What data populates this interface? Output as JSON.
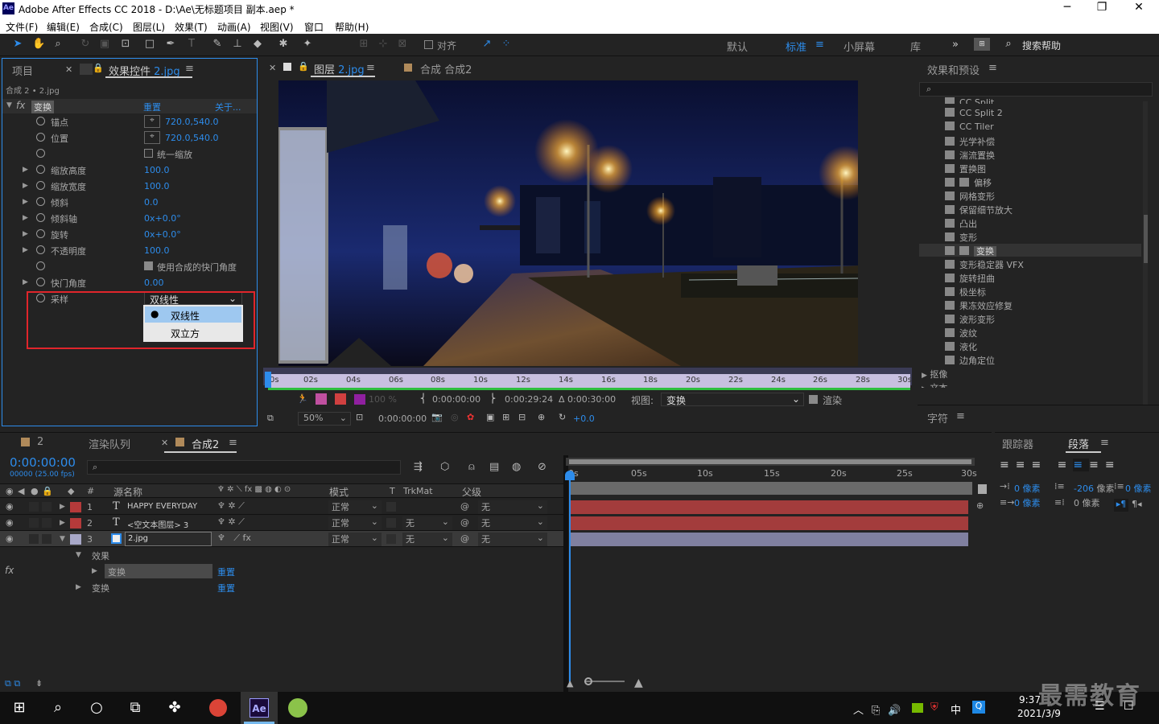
{
  "window": {
    "title": "Adobe After Effects CC 2018 - D:\\Ae\\无标题项目 副本.aep *",
    "logo": "Ae",
    "minimize": "─",
    "restore": "❐",
    "close": "✕"
  },
  "menu": [
    "文件(F)",
    "编辑(E)",
    "合成(C)",
    "图层(L)",
    "效果(T)",
    "动画(A)",
    "视图(V)",
    "窗口",
    "帮助(H)"
  ],
  "toolbar": {
    "align_label": "对齐",
    "workspaces": [
      "默认",
      "标准",
      "小屏幕",
      "库"
    ],
    "active_workspace": "标准",
    "search_help": "搜索帮助",
    "more": "»"
  },
  "left_panel": {
    "tab_project": "项目",
    "tab_effects_prefix": "效果控件",
    "tab_effects_layer": "2.jpg",
    "breadcrumb": "合成 2 • 2.jpg",
    "effect_name": "变换",
    "reset": "重置",
    "about": "关于...",
    "props": [
      {
        "label": "锚点",
        "value": "720.0,540.0"
      },
      {
        "label": "位置",
        "value": "720.0,540.0"
      },
      {
        "label": "",
        "check": "统一缩放"
      },
      {
        "label": "缩放高度",
        "value": "100.0"
      },
      {
        "label": "缩放宽度",
        "value": "100.0"
      },
      {
        "label": "倾斜",
        "value": "0.0"
      },
      {
        "label": "倾斜轴",
        "value": "0x+0.0°"
      },
      {
        "label": "旋转",
        "value": "0x+0.0°"
      },
      {
        "label": "不透明度",
        "value": "100.0"
      },
      {
        "label": "",
        "check": "使用合成的快门角度"
      },
      {
        "label": "快门角度",
        "value": "0.00"
      },
      {
        "label": "采样",
        "value": "双线性"
      }
    ],
    "dropdown_options": [
      "双线性",
      "双立方"
    ],
    "dropdown_selected": "双线性"
  },
  "viewer": {
    "tab_layer_prefix": "图层",
    "tab_layer_name": "2.jpg",
    "tab_comp": "合成 合成2",
    "ruler_ticks": [
      "0s",
      "02s",
      "04s",
      "06s",
      "08s",
      "10s",
      "12s",
      "14s",
      "16s",
      "18s",
      "20s",
      "22s",
      "24s",
      "26s",
      "28s",
      "30s"
    ],
    "opacity": "100 %",
    "in_time": "0:00:00:00",
    "out_time": "0:00:29:24",
    "duration": "Δ 0:00:30:00",
    "view_label": "视图:",
    "view_value": "变换",
    "render_label": "渲染",
    "zoom": "50%",
    "current_time": "0:00:00:00",
    "exposure": "+0.0"
  },
  "effects_presets": {
    "title": "效果和预设",
    "search_placeholder": "",
    "items": [
      "CC Split",
      "CC Split 2",
      "CC Tiler",
      "光学补偿",
      "湍流置换",
      "置换图",
      "偏移",
      "网格变形",
      "保留细节放大",
      "凸出",
      "变形",
      "变换",
      "变形稳定器 VFX",
      "旋转扭曲",
      "极坐标",
      "果冻效应修复",
      "波形变形",
      "波纹",
      "液化",
      "边角定位"
    ],
    "selected": "变换",
    "groups": [
      "抠像",
      "文本"
    ],
    "char_panel": "字符"
  },
  "timeline": {
    "tabs": [
      "2",
      "渲染队列",
      "合成2"
    ],
    "timecode": "0:00:00:00",
    "fps": "00000 (25.00 fps)",
    "columns": {
      "num": "#",
      "name": "源名称",
      "mode": "模式",
      "t": "T",
      "trkmat": "TrkMat",
      "parent": "父级"
    },
    "layers": [
      {
        "num": "1",
        "type": "T",
        "name": "HAPPY EVERYDAY",
        "mode": "正常",
        "trkmat": "",
        "parent": "无",
        "color": "#b53a3a"
      },
      {
        "num": "2",
        "type": "T",
        "name": "<空文本图层> 3",
        "mode": "正常",
        "trkmat": "无",
        "parent": "无",
        "color": "#b53a3a"
      },
      {
        "num": "3",
        "type": "img",
        "name": "2.jpg",
        "mode": "正常",
        "trkmat": "无",
        "parent": "无",
        "color": "#a8a8c8"
      }
    ],
    "sub_effects": "效果",
    "sub_transform_fx": "变换",
    "sub_transform": "变换",
    "reset": "重置",
    "time_ticks": [
      "0s",
      "05s",
      "10s",
      "15s",
      "20s",
      "25s",
      "30s"
    ]
  },
  "paragraph_panel": {
    "tab_tracker": "跟踪器",
    "tab_paragraph": "段落",
    "indent_left": "0 像素",
    "space_before_value": "-206",
    "space_before_unit": "像素",
    "indent_right": "0 像素",
    "indent_first": "0 像素",
    "space_after": "0 像素"
  },
  "taskbar": {
    "time": "9:37",
    "date": "2021/3/9",
    "ime": "中",
    "watermark": "最需教育"
  }
}
